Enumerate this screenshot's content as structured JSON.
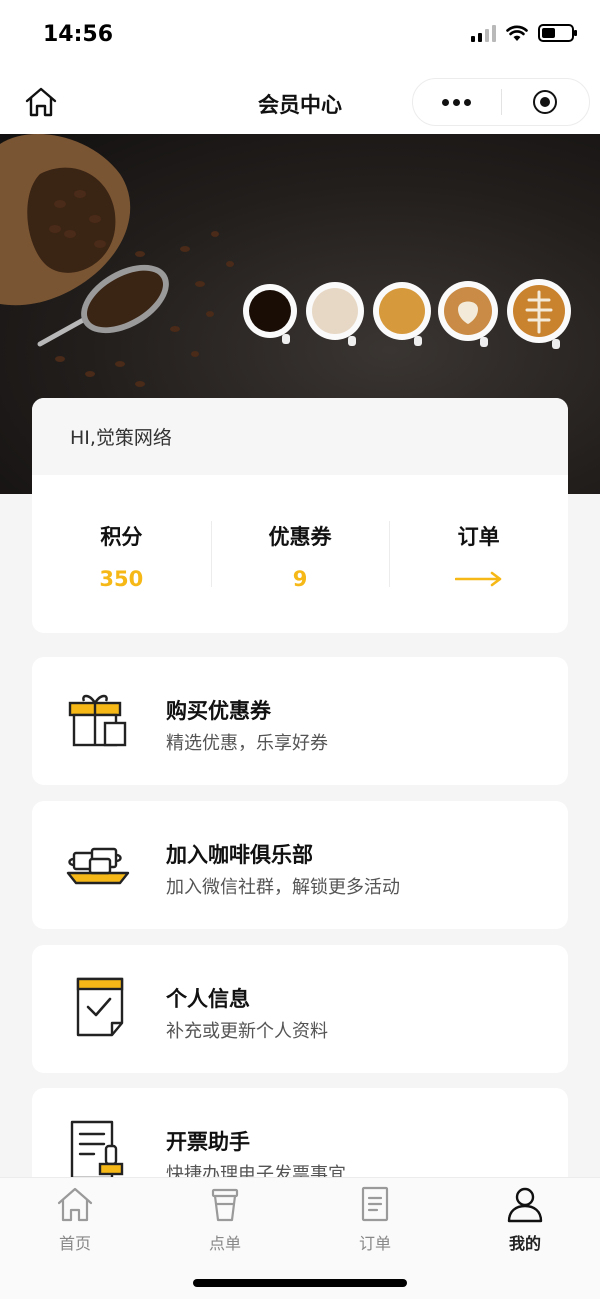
{
  "status_bar": {
    "time": "14:56"
  },
  "nav": {
    "title": "会员中心"
  },
  "member": {
    "greeting": "HI,觉策网络",
    "stats": [
      {
        "label": "积分",
        "value": "350"
      },
      {
        "label": "优惠券",
        "value": "9"
      },
      {
        "label": "订单"
      }
    ]
  },
  "menu": [
    {
      "title": "购买优惠券",
      "subtitle": "精选优惠，乐享好券",
      "icon": "gift-box-icon"
    },
    {
      "title": "加入咖啡俱乐部",
      "subtitle": "加入微信社群，解锁更多活动",
      "icon": "coffee-cups-tray-icon"
    },
    {
      "title": "个人信息",
      "subtitle": "补充或更新个人资料",
      "icon": "checklist-note-icon"
    },
    {
      "title": "开票助手",
      "subtitle": "快捷办理电子发票事宜",
      "icon": "invoice-icon"
    }
  ],
  "tab_bar": {
    "tabs": [
      {
        "label": "首页",
        "icon": "home-icon"
      },
      {
        "label": "点单",
        "icon": "cup-icon"
      },
      {
        "label": "订单",
        "icon": "document-icon"
      },
      {
        "label": "我的",
        "icon": "user-icon"
      }
    ],
    "active": 3
  },
  "colors": {
    "accent": "#f5b816",
    "background": "#f5f5f5",
    "card": "#ffffff"
  }
}
